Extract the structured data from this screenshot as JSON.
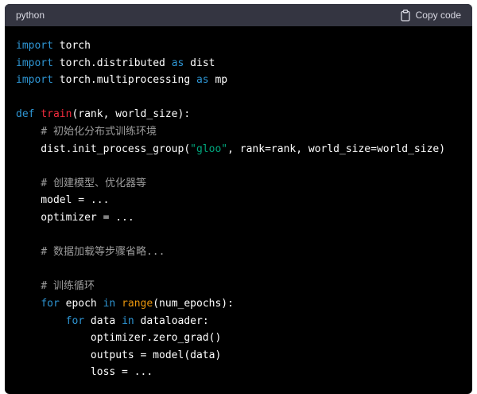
{
  "header": {
    "language": "python",
    "copy_label": "Copy code",
    "copy_icon": "clipboard-icon"
  },
  "colors": {
    "background": "#000000",
    "header_bg": "#343541",
    "keyword": "#2e95d3",
    "function_name": "#f22c3d",
    "string": "#00a67d",
    "builtin": "#e9950c",
    "comment": "#9b9b9b",
    "default": "#ffffff"
  },
  "code": {
    "lines": [
      [
        {
          "t": "kw",
          "v": "import"
        },
        {
          "t": "",
          "v": " torch"
        }
      ],
      [
        {
          "t": "kw",
          "v": "import"
        },
        {
          "t": "",
          "v": " torch.distributed "
        },
        {
          "t": "kw",
          "v": "as"
        },
        {
          "t": "",
          "v": " dist"
        }
      ],
      [
        {
          "t": "kw",
          "v": "import"
        },
        {
          "t": "",
          "v": " torch.multiprocessing "
        },
        {
          "t": "kw",
          "v": "as"
        },
        {
          "t": "",
          "v": " mp"
        }
      ],
      [],
      [
        {
          "t": "kw",
          "v": "def"
        },
        {
          "t": "",
          "v": " "
        },
        {
          "t": "fn",
          "v": "train"
        },
        {
          "t": "",
          "v": "(rank, world_size):"
        }
      ],
      [
        {
          "t": "",
          "v": "    "
        },
        {
          "t": "cm",
          "v": "# 初始化分布式训练环境"
        }
      ],
      [
        {
          "t": "",
          "v": "    dist.init_process_group("
        },
        {
          "t": "str",
          "v": "\"gloo\""
        },
        {
          "t": "",
          "v": ", rank=rank, world_size=world_size)"
        }
      ],
      [],
      [
        {
          "t": "",
          "v": "    "
        },
        {
          "t": "cm",
          "v": "# 创建模型、优化器等"
        }
      ],
      [
        {
          "t": "",
          "v": "    model = ..."
        }
      ],
      [
        {
          "t": "",
          "v": "    optimizer = ..."
        }
      ],
      [],
      [
        {
          "t": "",
          "v": "    "
        },
        {
          "t": "cm",
          "v": "# 数据加载等步骤省略..."
        }
      ],
      [],
      [
        {
          "t": "",
          "v": "    "
        },
        {
          "t": "cm",
          "v": "# 训练循环"
        }
      ],
      [
        {
          "t": "",
          "v": "    "
        },
        {
          "t": "kw",
          "v": "for"
        },
        {
          "t": "",
          "v": " epoch "
        },
        {
          "t": "kw",
          "v": "in"
        },
        {
          "t": "",
          "v": " "
        },
        {
          "t": "bi",
          "v": "range"
        },
        {
          "t": "",
          "v": "(num_epochs):"
        }
      ],
      [
        {
          "t": "",
          "v": "        "
        },
        {
          "t": "kw",
          "v": "for"
        },
        {
          "t": "",
          "v": " data "
        },
        {
          "t": "kw",
          "v": "in"
        },
        {
          "t": "",
          "v": " dataloader:"
        }
      ],
      [
        {
          "t": "",
          "v": "            optimizer.zero_grad()"
        }
      ],
      [
        {
          "t": "",
          "v": "            outputs = model(data)"
        }
      ],
      [
        {
          "t": "",
          "v": "            loss = ..."
        }
      ]
    ]
  }
}
